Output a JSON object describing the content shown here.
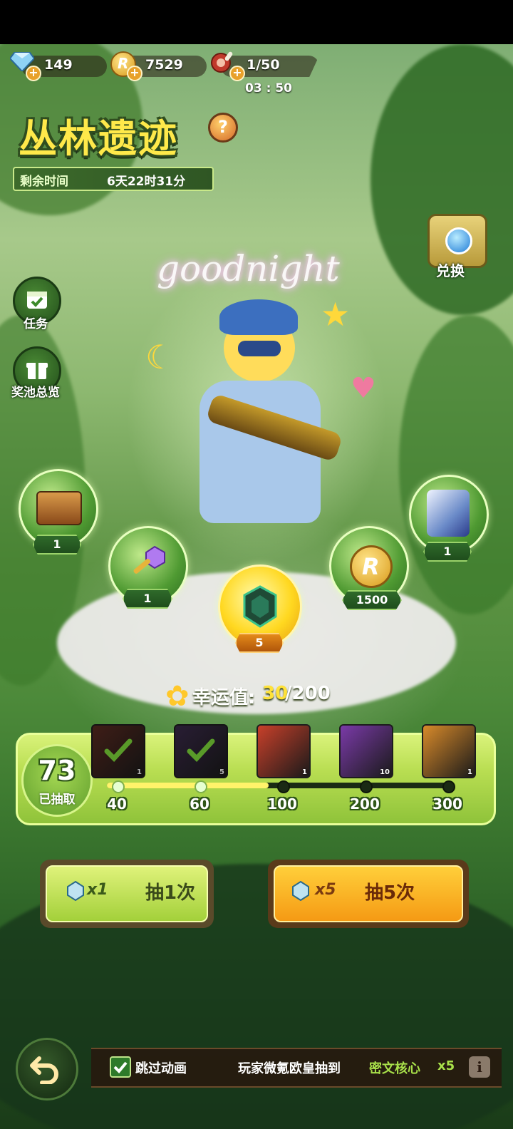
{
  "resources": {
    "diamonds": "149",
    "coins": "7529",
    "stamina": "1/50",
    "stamina_timer": "03 : 50"
  },
  "event": {
    "title": "丛林遗迹",
    "help_symbol": "?",
    "remaining_label": "剩余时间",
    "remaining_value": "6天22时31分"
  },
  "exchange": {
    "label": "兑换"
  },
  "banner_text": "goodnight",
  "side_menu": [
    {
      "label": "任务",
      "icon": "calendar-check-icon"
    },
    {
      "label": "奖池总览",
      "icon": "gift-icon"
    }
  ],
  "rewards": [
    {
      "name": "chest",
      "count": "1"
    },
    {
      "name": "key",
      "count": "1"
    },
    {
      "name": "core",
      "count": "5"
    },
    {
      "name": "coin",
      "count": "1500"
    },
    {
      "name": "mecha",
      "count": "1"
    }
  ],
  "luck": {
    "label": "幸运值:",
    "current": "30",
    "max": "/200"
  },
  "progress": {
    "drawn_count": "73",
    "drawn_label": "已抽取",
    "fill_fraction": 0.47,
    "milestones": [
      {
        "value": "40",
        "claimed": true,
        "qty": "1",
        "color": "#5a2a20"
      },
      {
        "value": "60",
        "claimed": true,
        "qty": "5",
        "color": "#3a2a4a"
      },
      {
        "value": "100",
        "claimed": false,
        "qty": "1",
        "color": "#c8402a"
      },
      {
        "value": "200",
        "claimed": false,
        "qty": "10",
        "color": "#7a3aa8"
      },
      {
        "value": "300",
        "claimed": false,
        "qty": "1",
        "color": "#d88a2a"
      }
    ]
  },
  "draw_buttons": {
    "single": {
      "mult": "x1",
      "label": "抽1次"
    },
    "multi": {
      "mult": "x5",
      "label": "抽5次"
    }
  },
  "footer": {
    "skip_label": "跳过动画",
    "skip_checked": true,
    "news_prefix": "玩家微氪欧皇抽到",
    "news_item": "密文核心",
    "news_qty": "x5",
    "info_symbol": "i"
  }
}
